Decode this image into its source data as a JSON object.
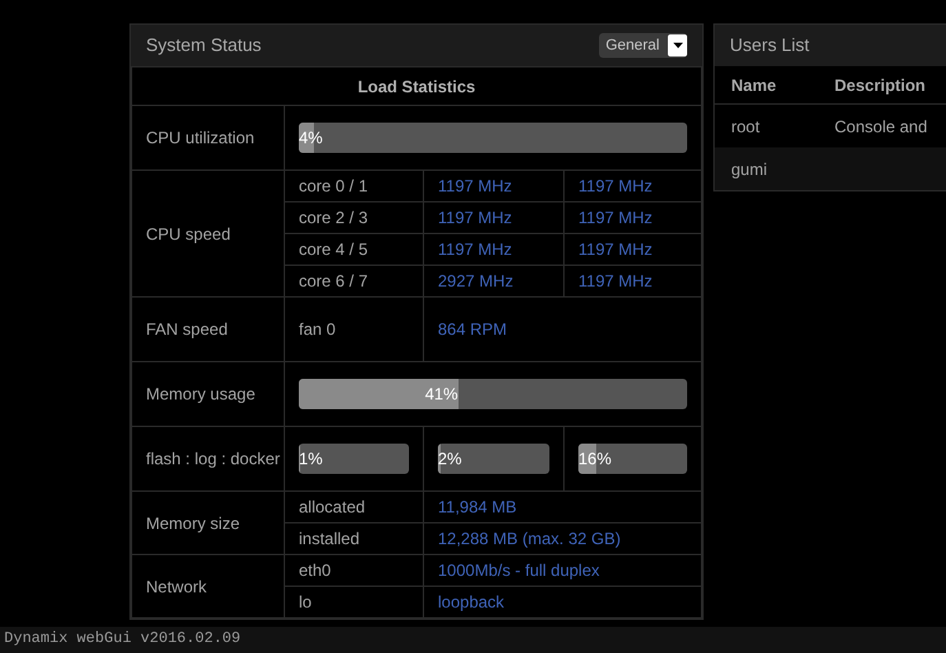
{
  "system_status": {
    "title": "System Status",
    "dropdown": {
      "value": "General"
    },
    "section_title": "Load Statistics",
    "cpu_utilization": {
      "label": "CPU utilization",
      "level": 0.04,
      "reading": "4%"
    },
    "cpu_speed": {
      "label": "CPU speed",
      "rows": [
        {
          "core": "core 0 / 1",
          "speed_a": "1197 MHz",
          "speed_b": "1197 MHz"
        },
        {
          "core": "core 2 / 3",
          "speed_a": "1197 MHz",
          "speed_b": "1197 MHz"
        },
        {
          "core": "core 4 / 5",
          "speed_a": "1197 MHz",
          "speed_b": "1197 MHz"
        },
        {
          "core": "core 6 / 7",
          "speed_a": "2927 MHz",
          "speed_b": "1197 MHz"
        }
      ]
    },
    "fan_speed": {
      "label": "FAN speed",
      "name": "fan 0",
      "reading": "864 RPM"
    },
    "memory_usage": {
      "label": "Memory usage",
      "level": 0.41,
      "reading": "41%"
    },
    "disk_usage": {
      "label": "flash : log : docker",
      "bars": [
        {
          "level": 0.01,
          "reading": "1%"
        },
        {
          "level": 0.02,
          "reading": "2%"
        },
        {
          "level": 0.16,
          "reading": "16%"
        }
      ]
    },
    "memory_size": {
      "label": "Memory size",
      "rows": [
        {
          "name": "allocated",
          "value": "11,984 MB"
        },
        {
          "name": "installed",
          "value": "12,288 MB (max. 32 GB)"
        }
      ]
    },
    "network": {
      "label": "Network",
      "rows": [
        {
          "name": "eth0",
          "value": "1000Mb/s - full duplex"
        },
        {
          "name": "lo",
          "value": "loopback"
        }
      ]
    }
  },
  "users_list": {
    "title": "Users List",
    "columns": [
      "Name",
      "Description"
    ],
    "rows": [
      {
        "name": "root",
        "description": "Console and"
      },
      {
        "name": "gumi",
        "description": ""
      }
    ]
  },
  "footer": {
    "version": "Dynamix webGui v2016.02.09"
  }
}
